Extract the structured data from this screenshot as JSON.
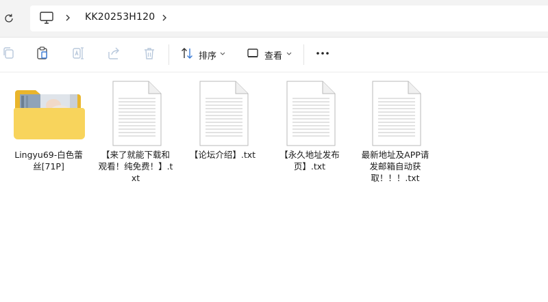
{
  "address_bar": {
    "breadcrumb": "KK20253H120"
  },
  "command_bar": {
    "sort_label": "排序",
    "view_label": "查看"
  },
  "files": [
    {
      "name": "Lingyu69-白色蕾丝[71P]",
      "type": "folder",
      "icon": "folder-icon"
    },
    {
      "name": "【来了就能下载和观看！纯免费！】.txt",
      "type": "text",
      "icon": "text-file-icon"
    },
    {
      "name": "【论坛介绍】.txt",
      "type": "text",
      "icon": "text-file-icon"
    },
    {
      "name": "【永久地址发布页】.txt",
      "type": "text",
      "icon": "text-file-icon"
    },
    {
      "name": "最新地址及APP请发邮箱自动获取！！！.txt",
      "type": "text",
      "icon": "text-file-icon"
    }
  ],
  "colors": {
    "folder_yellow": "#f8d45c",
    "folder_back": "#e9b52c",
    "accent": "#005fb8"
  }
}
